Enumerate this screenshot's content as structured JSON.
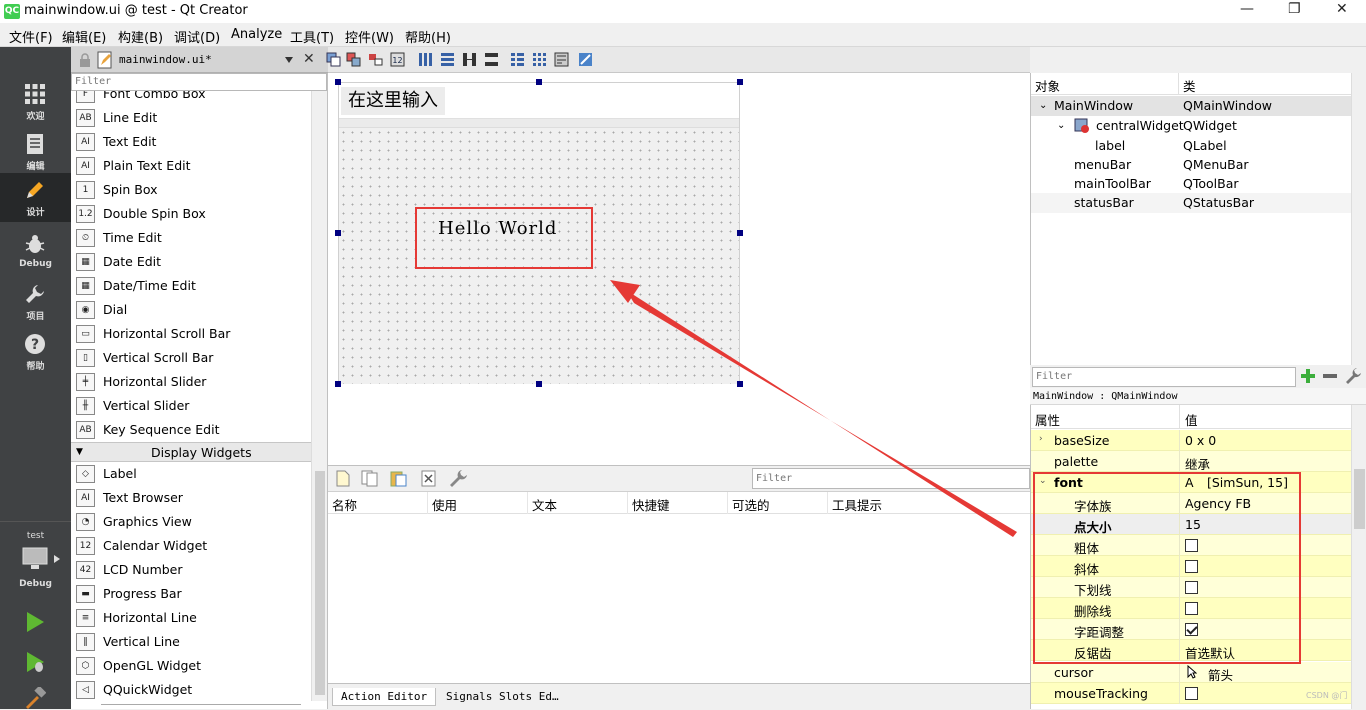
{
  "window": {
    "app_icon_text": "QC",
    "title": "mainwindow.ui @ test - Qt Creator",
    "minimize": "—",
    "restore": "❐",
    "close": "✕"
  },
  "menu": [
    "文件(F)",
    "编辑(E)",
    "构建(B)",
    "调试(D)",
    "Analyze",
    "工具(T)",
    "控件(W)",
    "帮助(H)"
  ],
  "modes": [
    {
      "label": "欢迎",
      "icon": "grid-icon"
    },
    {
      "label": "编辑",
      "icon": "edit-doc-icon"
    },
    {
      "label": "设计",
      "icon": "pencil-icon"
    },
    {
      "label": "Debug",
      "icon": "bug-icon"
    },
    {
      "label": "项目",
      "icon": "wrench-icon"
    },
    {
      "label": "帮助",
      "icon": "help-icon"
    }
  ],
  "kit": {
    "project": "test",
    "config": "Debug"
  },
  "document_tab": {
    "name": "mainwindow.ui*",
    "close": "✕"
  },
  "widget_box": {
    "filter_placeholder": "Filter",
    "items_top": [
      {
        "label": "Font Combo Box",
        "icon": "F"
      },
      {
        "label": "Line Edit",
        "icon": "AB"
      },
      {
        "label": "Text Edit",
        "icon": "AI"
      },
      {
        "label": "Plain Text Edit",
        "icon": "AI"
      },
      {
        "label": "Spin Box",
        "icon": "1"
      },
      {
        "label": "Double Spin Box",
        "icon": "1.2"
      },
      {
        "label": "Time Edit",
        "icon": "⏲"
      },
      {
        "label": "Date Edit",
        "icon": "▦"
      },
      {
        "label": "Date/Time Edit",
        "icon": "▦"
      },
      {
        "label": "Dial",
        "icon": "◉"
      },
      {
        "label": "Horizontal Scroll Bar",
        "icon": "▭"
      },
      {
        "label": "Vertical Scroll Bar",
        "icon": "▯"
      },
      {
        "label": "Horizontal Slider",
        "icon": "╪"
      },
      {
        "label": "Vertical Slider",
        "icon": "╫"
      },
      {
        "label": "Key Sequence Edit",
        "icon": "AB"
      }
    ],
    "category": "Display Widgets",
    "items_display": [
      {
        "label": "Label",
        "icon": "◇"
      },
      {
        "label": "Text Browser",
        "icon": "AI"
      },
      {
        "label": "Graphics View",
        "icon": "◔"
      },
      {
        "label": "Calendar Widget",
        "icon": "12"
      },
      {
        "label": "LCD Number",
        "icon": "42"
      },
      {
        "label": "Progress Bar",
        "icon": "▬"
      },
      {
        "label": "Horizontal Line",
        "icon": "≡"
      },
      {
        "label": "Vertical Line",
        "icon": "‖"
      },
      {
        "label": "OpenGL Widget",
        "icon": "⬡"
      },
      {
        "label": "QQuickWidget",
        "icon": "◁"
      }
    ]
  },
  "form": {
    "menu_text": "在这里输入",
    "label_text": "Hello World"
  },
  "action_editor": {
    "filter_placeholder": "Filter",
    "columns": [
      "名称",
      "使用",
      "文本",
      "快捷键",
      "可选的",
      "工具提示"
    ],
    "tabs": [
      "Action Editor",
      "Signals  Slots Ed…"
    ]
  },
  "object_inspector": {
    "headers": [
      "对象",
      "类"
    ],
    "rows": [
      {
        "object": "MainWindow",
        "class": "QMainWindow"
      },
      {
        "object": "centralWidget",
        "class": "QWidget"
      },
      {
        "object": "label",
        "class": "QLabel"
      },
      {
        "object": "menuBar",
        "class": "QMenuBar"
      },
      {
        "object": "mainToolBar",
        "class": "QToolBar"
      },
      {
        "object": "statusBar",
        "class": "QStatusBar"
      }
    ]
  },
  "property_editor": {
    "filter_placeholder": "Filter",
    "title": "MainWindow : QMainWindow",
    "headers": [
      "属性",
      "值"
    ],
    "rows": [
      {
        "name": "baseSize",
        "value": "0 x 0"
      },
      {
        "name": "palette",
        "value": "继承"
      },
      {
        "name": "font",
        "value": "[SimSun, 15]",
        "value_icon": "A"
      },
      {
        "name": "字体族",
        "value": "Agency FB"
      },
      {
        "name": "点大小",
        "value": "15"
      },
      {
        "name": "粗体",
        "checked": false
      },
      {
        "name": "斜体",
        "checked": false
      },
      {
        "name": "下划线",
        "checked": false
      },
      {
        "name": "删除线",
        "checked": false
      },
      {
        "name": "字距调整",
        "checked": true
      },
      {
        "name": "反锯齿",
        "value": "首选默认"
      },
      {
        "name": "cursor",
        "value": "箭头"
      },
      {
        "name": "mouseTracking",
        "checked": false
      }
    ]
  },
  "watermark": "CSDN @门",
  "colors": {
    "annotation_red": "#e53935",
    "mode_bar": "#404244",
    "property_row": "#ffffc0",
    "selection_handle": "#000080"
  }
}
